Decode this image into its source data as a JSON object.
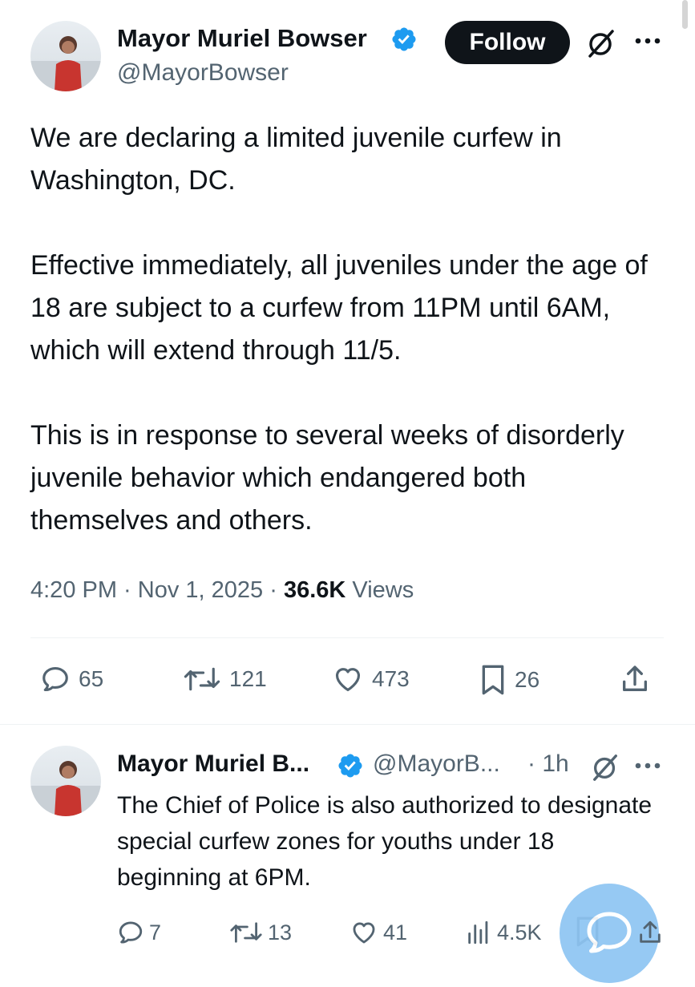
{
  "colors": {
    "text": "#0f1419",
    "muted": "#536471",
    "verified": "#1d9bf0",
    "follow_bg": "#0f1419",
    "fab": "#8ec5f3"
  },
  "main_tweet": {
    "author_name": "Mayor Muriel Bowser",
    "author_handle": "@MayorBowser",
    "follow_label": "Follow",
    "paragraphs": [
      "We are declaring a limited juvenile curfew in Washington, DC.",
      "Effective immediately, all juveniles under the age of 18 are subject to a curfew from 11PM until 6AM, which will extend through 11/5.",
      "This is in response to several weeks of disorderly juvenile behavior which endangered both themselves and others."
    ],
    "timestamp": "4:20 PM · Nov 1, 2025 · ",
    "views_count": "36.6K",
    "views_label": " Views",
    "actions": {
      "replies": "65",
      "reposts": "121",
      "likes": "473",
      "bookmarks": "26"
    }
  },
  "reply_tweet": {
    "author_name": "Mayor Muriel B...",
    "author_handle": "@MayorB...",
    "time": "· 1h",
    "text": "The Chief of Police is also authorized to designate special curfew zones for youths under 18 beginning at 6PM.",
    "actions": {
      "replies": "7",
      "reposts": "13",
      "likes": "41",
      "views": "4.5K"
    }
  }
}
